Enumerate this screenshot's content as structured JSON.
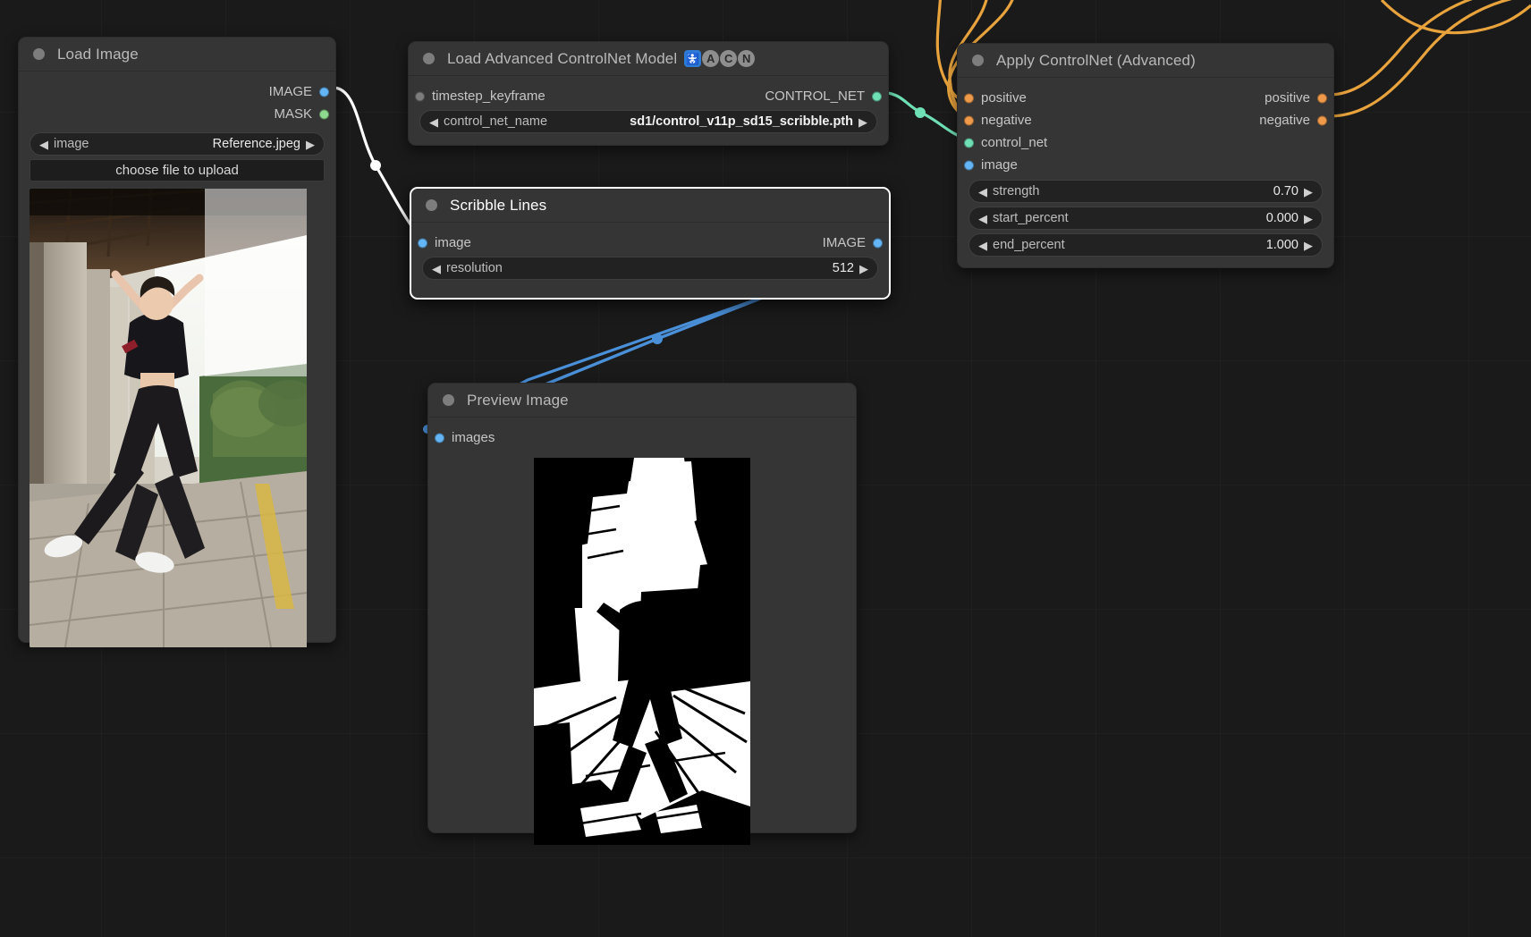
{
  "app": {
    "background": "#1a1a1a",
    "grid_color": "rgba(255,255,255,0.022)"
  },
  "colors": {
    "image_slot": "#64b5f6",
    "mask_slot": "#8fd98f",
    "conditioning_slot": "#ef9a4a",
    "controlnet_slot": "#6fdfb5",
    "node_body": "#353535",
    "widget_bg": "#222222",
    "link_image": "#ffffff",
    "link_blue": "#4a90d9",
    "link_control": "#6fdfb5",
    "link_cond": "#e8a33d"
  },
  "nodes": [
    {
      "id": "load-image",
      "title": "Load Image",
      "outputs": [
        {
          "name": "IMAGE",
          "color": "image"
        },
        {
          "name": "MASK",
          "color": "mask"
        }
      ],
      "widgets": [
        {
          "type": "combo",
          "name": "image",
          "value": "Reference.jpeg"
        },
        {
          "type": "button",
          "name": "choose file to upload"
        }
      ]
    },
    {
      "id": "load-advanced-controlnet-model",
      "title": "Load Advanced ControlNet Model",
      "badges": [
        "🚼",
        "A",
        "C",
        "N"
      ],
      "inputs": [
        {
          "name": "timestep_keyframe",
          "color": "generic"
        }
      ],
      "outputs": [
        {
          "name": "CONTROL_NET",
          "color": "control"
        }
      ],
      "widgets": [
        {
          "type": "combo",
          "name": "control_net_name",
          "value": "sd1/control_v11p_sd15_scribble.pth"
        }
      ]
    },
    {
      "id": "scribble-lines",
      "title": "Scribble Lines",
      "selected": true,
      "inputs": [
        {
          "name": "image",
          "color": "image"
        }
      ],
      "outputs": [
        {
          "name": "IMAGE",
          "color": "image"
        }
      ],
      "widgets": [
        {
          "type": "combo",
          "name": "resolution",
          "value": "512"
        }
      ]
    },
    {
      "id": "apply-controlnet-advanced",
      "title": "Apply ControlNet (Advanced)",
      "inputs": [
        {
          "name": "positive",
          "color": "cond"
        },
        {
          "name": "negative",
          "color": "cond"
        },
        {
          "name": "control_net",
          "color": "control"
        },
        {
          "name": "image",
          "color": "image"
        }
      ],
      "outputs": [
        {
          "name": "positive",
          "color": "cond"
        },
        {
          "name": "negative",
          "color": "cond"
        }
      ],
      "widgets": [
        {
          "type": "number",
          "name": "strength",
          "value": "0.70"
        },
        {
          "type": "number",
          "name": "start_percent",
          "value": "0.000"
        },
        {
          "type": "number",
          "name": "end_percent",
          "value": "1.000"
        }
      ]
    },
    {
      "id": "preview-image",
      "title": "Preview Image",
      "inputs": [
        {
          "name": "images",
          "color": "image"
        }
      ]
    }
  ],
  "arrows": {
    "left": "◀",
    "right": "▶"
  }
}
